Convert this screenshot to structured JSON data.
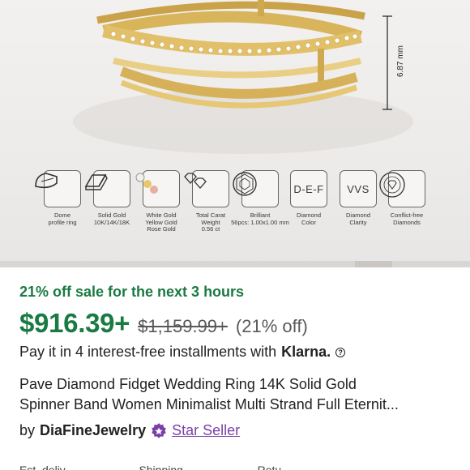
{
  "image": {
    "measurement": "6.87 mm"
  },
  "features": [
    {
      "icon": "dome-profile-icon",
      "caption": [
        "Dome",
        "profile ring"
      ]
    },
    {
      "icon": "gold-bar-icon",
      "caption": [
        "Solid Gold",
        "10K/14K/18K"
      ]
    },
    {
      "icon": "color-dots-icon",
      "caption": [
        "White Gold",
        "Yellow Gold",
        "Rose Gold"
      ]
    },
    {
      "icon": "diamonds-icon",
      "caption": [
        "Total Carat",
        "Weight",
        "0.56 ct"
      ]
    },
    {
      "icon": "brilliant-cut-icon",
      "caption": [
        "Brilliant",
        "56pcs: 1.00x1.00 mm"
      ]
    },
    {
      "icon": "color-grade-icon",
      "text": "D-E-F",
      "caption": [
        "Diamond",
        "Color"
      ]
    },
    {
      "icon": "clarity-grade-icon",
      "text": "VVS",
      "caption": [
        "Diamond",
        "Clarity"
      ]
    },
    {
      "icon": "conflict-free-icon",
      "caption": [
        "Conflict-free",
        "Diamonds"
      ]
    }
  ],
  "sale_text": "21% off sale for the next 3 hours",
  "price": "$916.39+",
  "original_price": "$1,159.99+",
  "discount": "(21% off)",
  "installments": "Pay it in 4 interest-free installments with",
  "klarna": "Klarna.",
  "help": "?",
  "title_lines": [
    "Pave Diamond Fidget Wedding Ring 14K Solid Gold",
    "Spinner Band Women Minimalist Multi Strand Full Eternit..."
  ],
  "seller": {
    "by": "by",
    "shop": "DiaFineJewelry",
    "badge": "Star Seller"
  },
  "bottom_tabs": [
    "Est. deliv...",
    "Shipping...",
    "Retu..."
  ],
  "colors": {
    "sale_green": "#1b7a43",
    "star_purple": "#7b3fa8",
    "gold": "#d8b45a"
  }
}
